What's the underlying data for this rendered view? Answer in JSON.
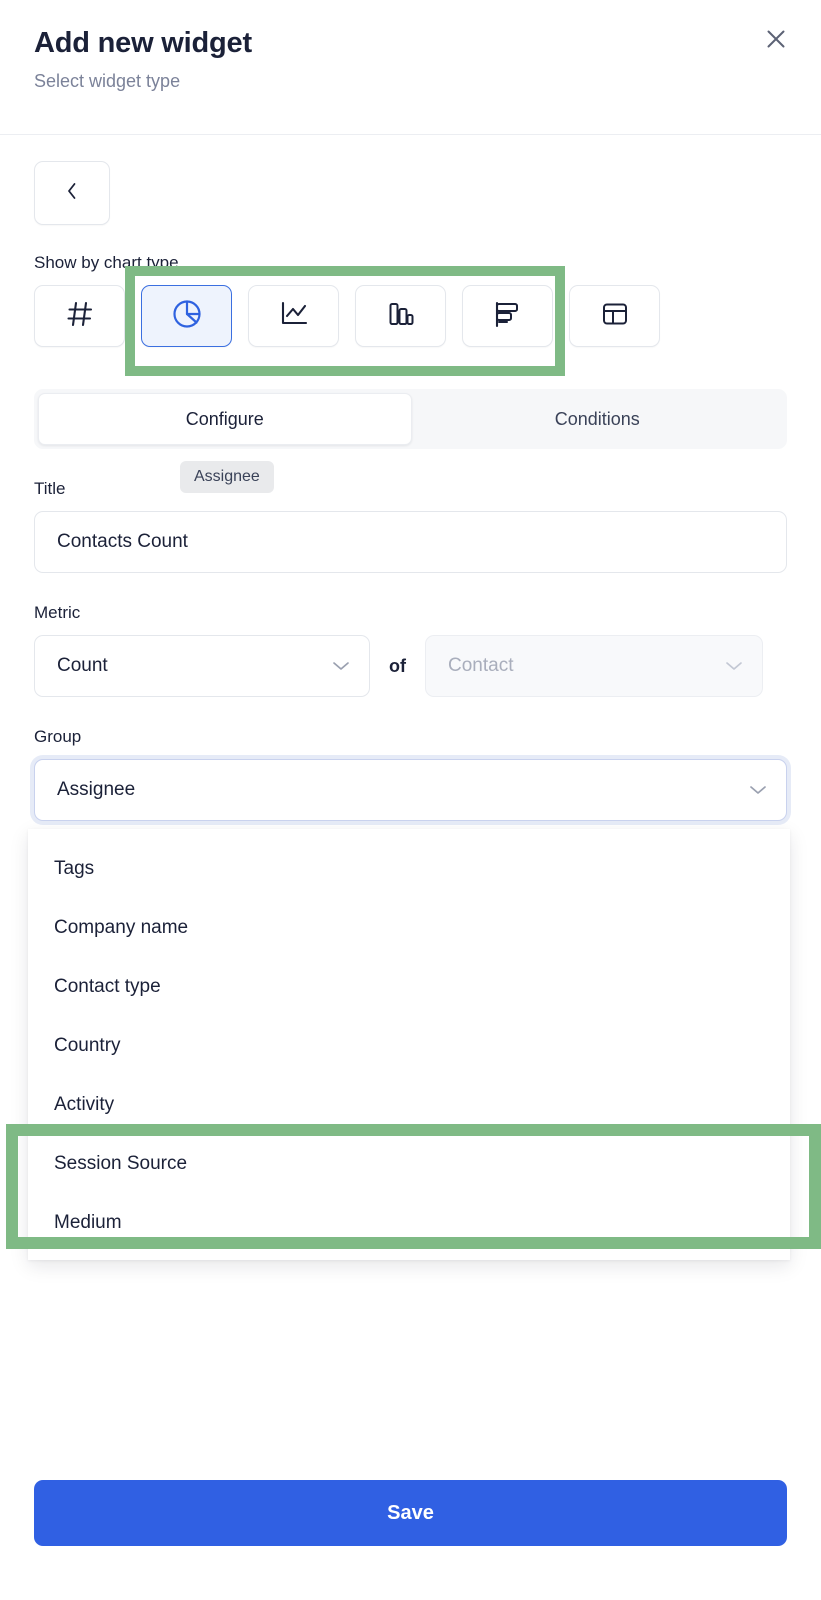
{
  "header": {
    "title": "Add new widget",
    "subtitle": "Select widget type",
    "close_icon": "close-icon"
  },
  "back_button": {
    "icon": "chevron-left-icon"
  },
  "chart_type": {
    "label": "Show by chart type",
    "selected": "pie",
    "options": [
      {
        "id": "number",
        "icon": "hash-icon",
        "selected": false
      },
      {
        "id": "pie",
        "icon": "pie-chart-icon",
        "selected": true
      },
      {
        "id": "line",
        "icon": "line-chart-icon",
        "selected": false
      },
      {
        "id": "column",
        "icon": "bar-chart-vertical-icon",
        "selected": false
      },
      {
        "id": "bar",
        "icon": "bar-chart-horizontal-icon",
        "selected": false
      },
      {
        "id": "table",
        "icon": "table-icon",
        "selected": false
      }
    ],
    "highlight_color": "#7fba85"
  },
  "tabs": [
    {
      "label": "Configure",
      "active": true
    },
    {
      "label": "Conditions",
      "active": false
    }
  ],
  "tooltip": {
    "text": "Assignee"
  },
  "title_field": {
    "label": "Title",
    "value": "Contacts Count",
    "placeholder": "Title"
  },
  "metric": {
    "label": "Metric",
    "aggregate_value": "Count",
    "conjunction": "of",
    "entity_value": "Contact",
    "chevron_icon": "chevron-down-icon"
  },
  "group": {
    "label": "Group",
    "value": "Assignee",
    "chevron_icon": "chevron-down-icon",
    "options": [
      "Tags",
      "Company name",
      "Contact type",
      "Country",
      "Activity",
      "Session Source",
      "Medium"
    ],
    "highlighted_options": [
      "Session Source",
      "Medium"
    ]
  },
  "footer": {
    "save_label": "Save",
    "save_color": "#3060e3"
  }
}
